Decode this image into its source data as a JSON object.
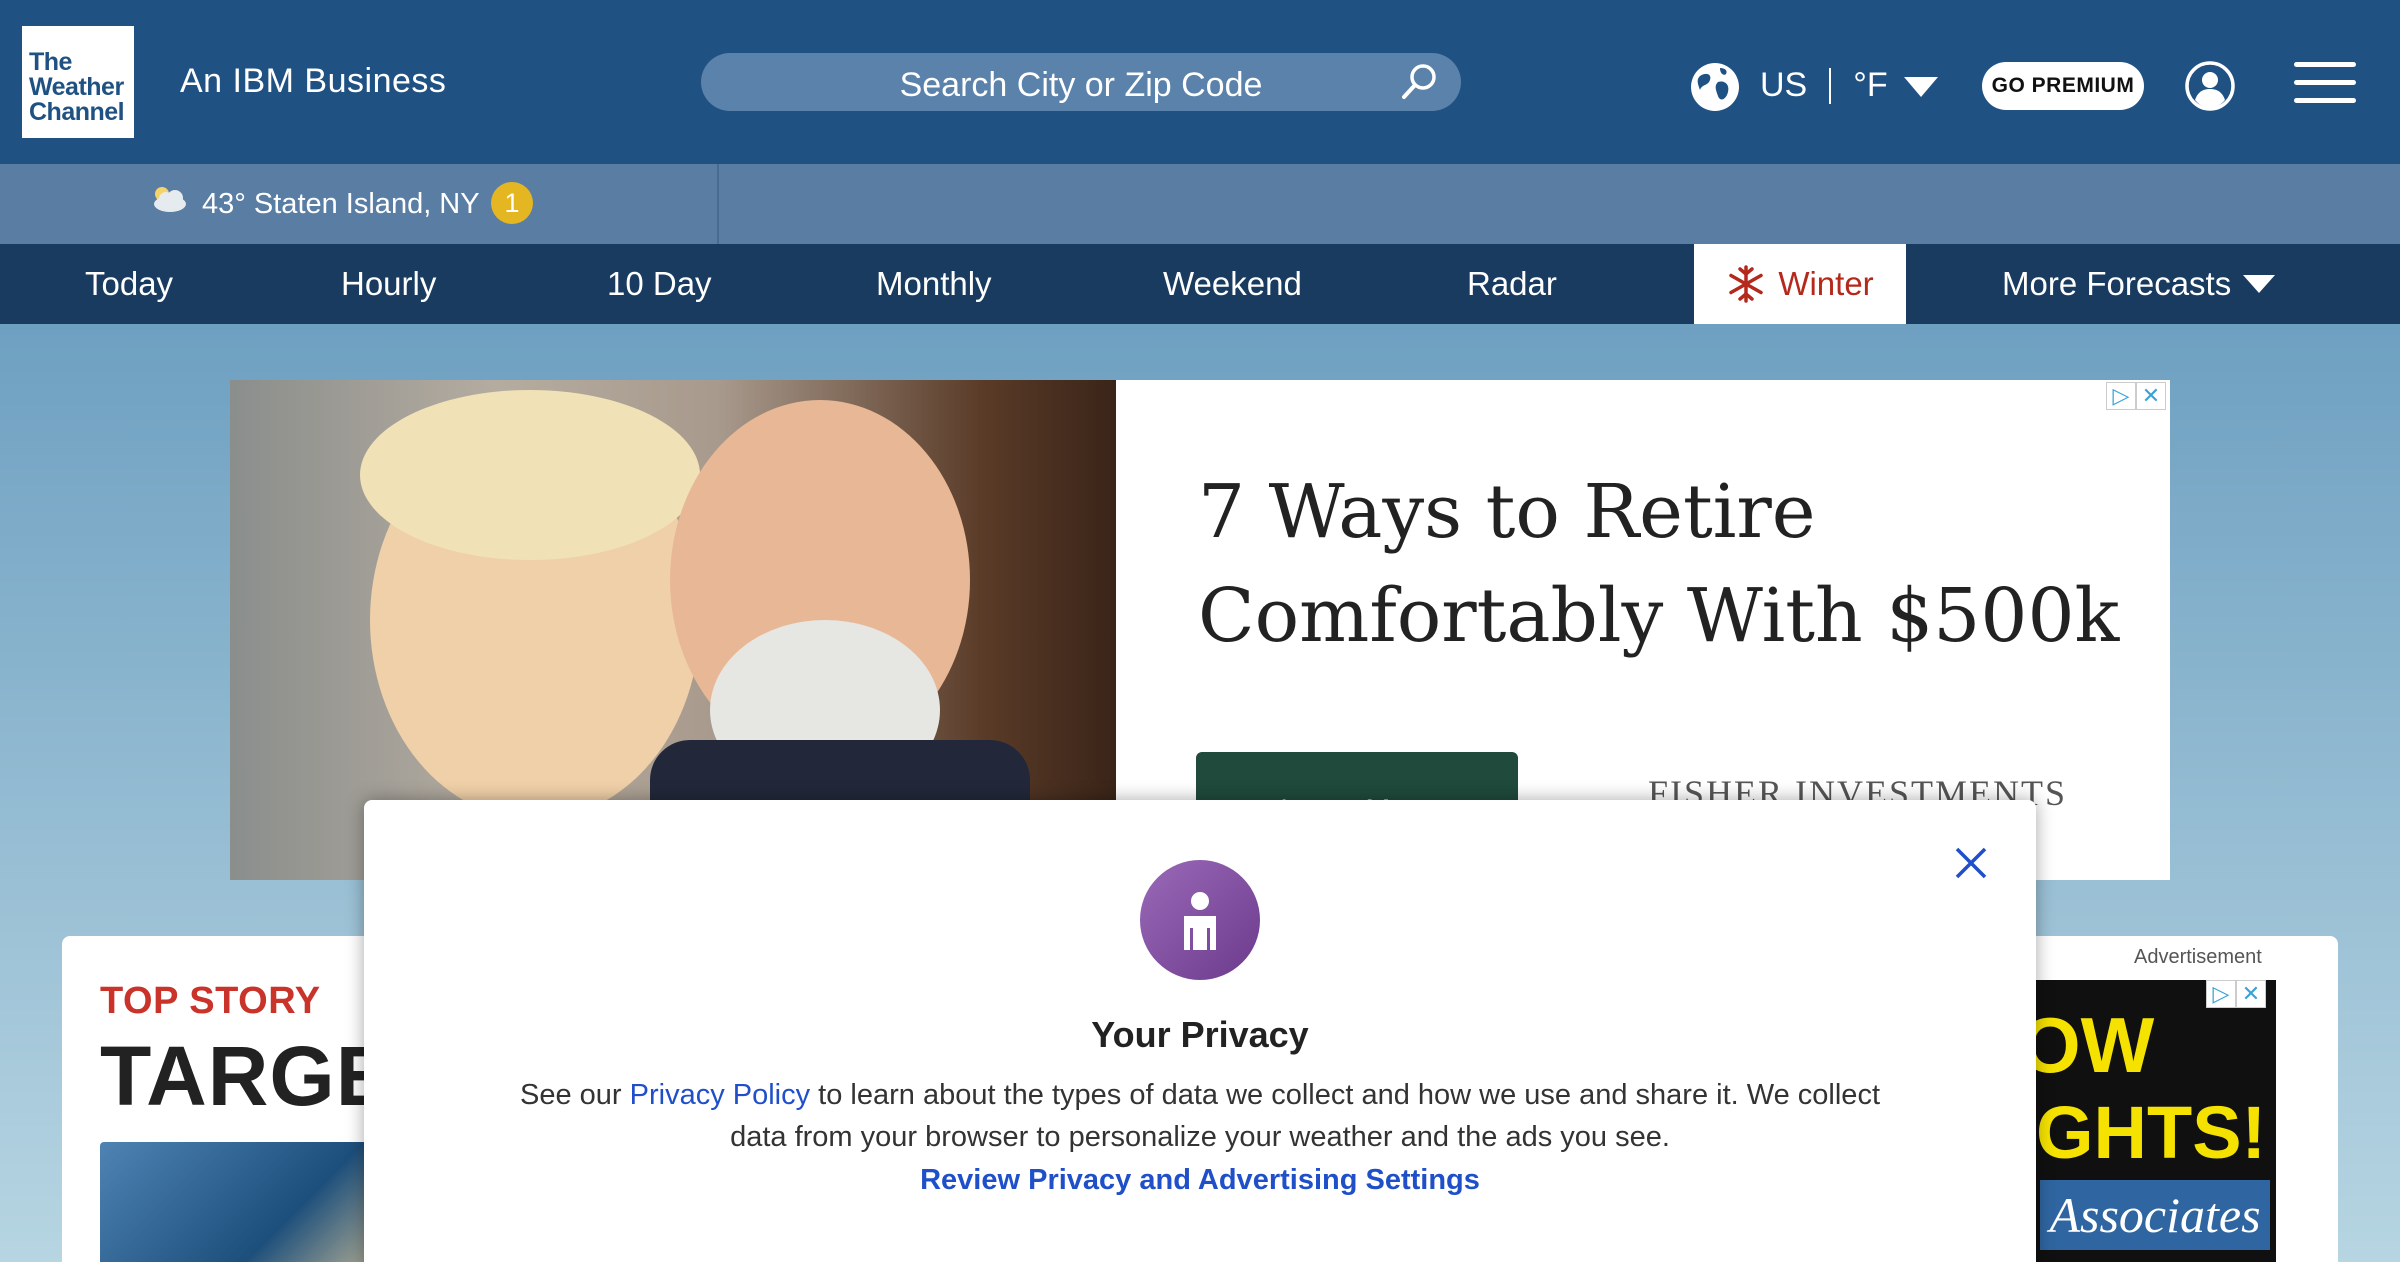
{
  "header": {
    "logo_lines": [
      "The",
      "Weather",
      "Channel"
    ],
    "tagline": "An IBM Business",
    "search_placeholder": "Search City or Zip Code",
    "locale_country": "US",
    "locale_unit": "°F",
    "premium_label": "GO PREMIUM"
  },
  "location_bar": {
    "temp_location": "43° Staten Island, NY",
    "alert_count": "1"
  },
  "nav": {
    "items": [
      "Today",
      "Hourly",
      "10 Day",
      "Monthly",
      "Weekend",
      "Radar",
      "Winter",
      "More Forecasts"
    ]
  },
  "ad": {
    "title": "7 Ways to Retire Comfortably With $500k",
    "button": "Learn More",
    "brand": "FISHER INVESTMENTS"
  },
  "story": {
    "kicker": "TOP STORY",
    "headline": "TARGET"
  },
  "side_ad": {
    "label": "Advertisement",
    "line1": "OW",
    "line2": "GHTS!",
    "line3": "Associates"
  },
  "privacy": {
    "title": "Your Privacy",
    "body_prefix": "See our ",
    "policy_link": "Privacy Policy",
    "body_suffix": " to learn about the types of data we collect and how we use and share it. We collect data from your browser to personalize your weather and the ads you see.",
    "settings_link": "Review Privacy and Advertising Settings"
  },
  "colors": {
    "header_bg": "#1f5183",
    "nav_bg": "#183b5f",
    "winter_accent": "#b5291d",
    "link": "#1f4fc9",
    "kicker": "#c9332a"
  }
}
